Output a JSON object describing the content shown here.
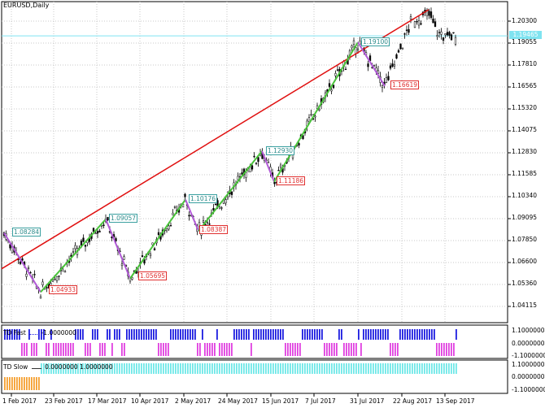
{
  "chart": {
    "symbol_label": "EURUSD,Daily",
    "price_axis": [
      "1.20300",
      "1.19055",
      "1.17810",
      "1.16565",
      "1.15320",
      "1.14075",
      "1.12830",
      "1.11585",
      "1.10340",
      "1.09095",
      "1.07850",
      "1.06600",
      "1.05360",
      "1.04115"
    ],
    "date_axis": [
      "1 Feb 2017",
      "23 Feb 2017",
      "17 Mar 2017",
      "10 Apr 2017",
      "2 May 2017",
      "24 May 2017",
      "15 Jun 2017",
      "7 Jul 2017",
      "31 Jul 2017",
      "22 Aug 2017",
      "13 Sep 2017"
    ],
    "current_price": "1.19465",
    "bid_color": "#7fe3f0",
    "trend_color": "#e01010",
    "up_swing_color": "#49c23a",
    "down_swing_color": "#b15ad6",
    "swing_labels": [
      {
        "text": "1.08284",
        "kind": "high"
      },
      {
        "text": "1.04933",
        "kind": "low"
      },
      {
        "text": "1.09057",
        "kind": "high"
      },
      {
        "text": "1.05695",
        "kind": "low"
      },
      {
        "text": "1.10176",
        "kind": "high"
      },
      {
        "text": "1.08387",
        "kind": "low"
      },
      {
        "text": "1.12930",
        "kind": "high"
      },
      {
        "text": "1.11186",
        "kind": "low"
      },
      {
        "text": "1.19100",
        "kind": "high"
      },
      {
        "text": "1.16619",
        "kind": "low"
      }
    ]
  },
  "td_fast": {
    "label": "TD Fast",
    "value": "-1.0000000",
    "axis": [
      "1.1000000",
      "0.0000000",
      "-1.1000000"
    ],
    "up_color": "#1d1de0",
    "down_color": "#e040e0"
  },
  "td_slow": {
    "label": "TD Slow",
    "values": "0.0000000 1.0000000",
    "axis": [
      "1.1000000",
      "0.0000000",
      "-1.1000000"
    ],
    "up_color": "#6fe8e8",
    "down_color": "#f5a030"
  }
}
